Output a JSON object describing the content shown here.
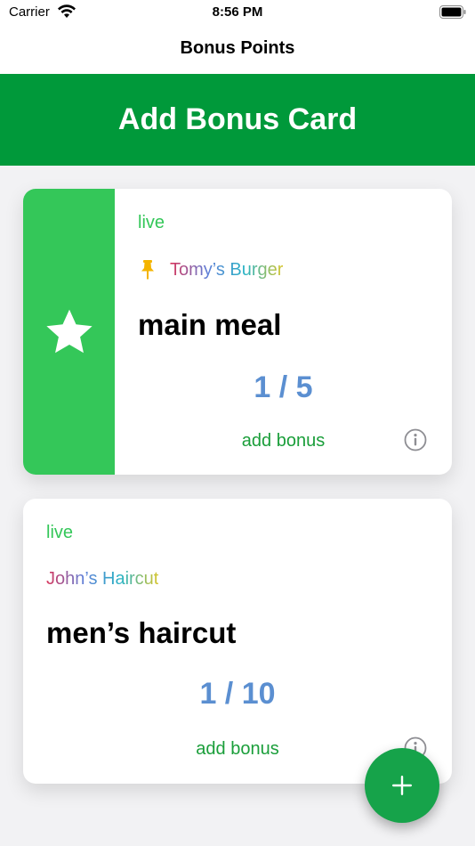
{
  "status_bar": {
    "carrier": "Carrier",
    "time": "8:56 PM"
  },
  "nav": {
    "title": "Bonus Points"
  },
  "banner": {
    "label": "Add Bonus Card"
  },
  "cards": [
    {
      "status": "live",
      "merchant": "Tomy’s Burger",
      "pinned": true,
      "starred": true,
      "title": "main meal",
      "progress": "1 / 5",
      "action": "add bonus"
    },
    {
      "status": "live",
      "merchant": "John’s Haircut",
      "pinned": false,
      "starred": false,
      "title": "men’s haircut",
      "progress": "1 / 10",
      "action": "add bonus"
    }
  ],
  "colors": {
    "brand_green": "#00993a",
    "status_green": "#34c759",
    "progress_blue": "#5b8fd1",
    "fab_green": "#16a34a"
  },
  "icons": [
    "wifi-icon",
    "battery-icon",
    "star-icon",
    "pin-icon",
    "info-icon",
    "plus-icon"
  ]
}
